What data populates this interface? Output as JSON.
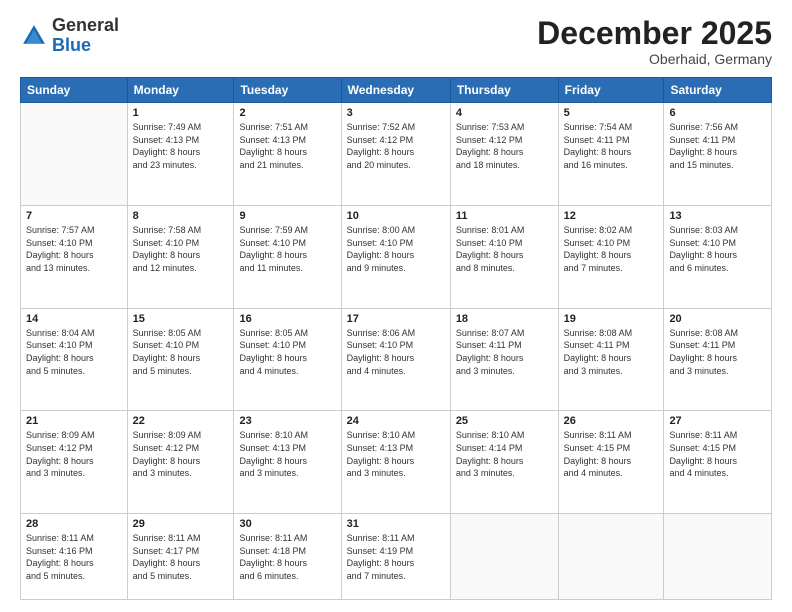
{
  "logo": {
    "general": "General",
    "blue": "Blue"
  },
  "header": {
    "month": "December 2025",
    "location": "Oberhaid, Germany"
  },
  "weekdays": [
    "Sunday",
    "Monday",
    "Tuesday",
    "Wednesday",
    "Thursday",
    "Friday",
    "Saturday"
  ],
  "weeks": [
    [
      {
        "day": "",
        "info": ""
      },
      {
        "day": "1",
        "info": "Sunrise: 7:49 AM\nSunset: 4:13 PM\nDaylight: 8 hours\nand 23 minutes."
      },
      {
        "day": "2",
        "info": "Sunrise: 7:51 AM\nSunset: 4:13 PM\nDaylight: 8 hours\nand 21 minutes."
      },
      {
        "day": "3",
        "info": "Sunrise: 7:52 AM\nSunset: 4:12 PM\nDaylight: 8 hours\nand 20 minutes."
      },
      {
        "day": "4",
        "info": "Sunrise: 7:53 AM\nSunset: 4:12 PM\nDaylight: 8 hours\nand 18 minutes."
      },
      {
        "day": "5",
        "info": "Sunrise: 7:54 AM\nSunset: 4:11 PM\nDaylight: 8 hours\nand 16 minutes."
      },
      {
        "day": "6",
        "info": "Sunrise: 7:56 AM\nSunset: 4:11 PM\nDaylight: 8 hours\nand 15 minutes."
      }
    ],
    [
      {
        "day": "7",
        "info": "Sunrise: 7:57 AM\nSunset: 4:10 PM\nDaylight: 8 hours\nand 13 minutes."
      },
      {
        "day": "8",
        "info": "Sunrise: 7:58 AM\nSunset: 4:10 PM\nDaylight: 8 hours\nand 12 minutes."
      },
      {
        "day": "9",
        "info": "Sunrise: 7:59 AM\nSunset: 4:10 PM\nDaylight: 8 hours\nand 11 minutes."
      },
      {
        "day": "10",
        "info": "Sunrise: 8:00 AM\nSunset: 4:10 PM\nDaylight: 8 hours\nand 9 minutes."
      },
      {
        "day": "11",
        "info": "Sunrise: 8:01 AM\nSunset: 4:10 PM\nDaylight: 8 hours\nand 8 minutes."
      },
      {
        "day": "12",
        "info": "Sunrise: 8:02 AM\nSunset: 4:10 PM\nDaylight: 8 hours\nand 7 minutes."
      },
      {
        "day": "13",
        "info": "Sunrise: 8:03 AM\nSunset: 4:10 PM\nDaylight: 8 hours\nand 6 minutes."
      }
    ],
    [
      {
        "day": "14",
        "info": "Sunrise: 8:04 AM\nSunset: 4:10 PM\nDaylight: 8 hours\nand 5 minutes."
      },
      {
        "day": "15",
        "info": "Sunrise: 8:05 AM\nSunset: 4:10 PM\nDaylight: 8 hours\nand 5 minutes."
      },
      {
        "day": "16",
        "info": "Sunrise: 8:05 AM\nSunset: 4:10 PM\nDaylight: 8 hours\nand 4 minutes."
      },
      {
        "day": "17",
        "info": "Sunrise: 8:06 AM\nSunset: 4:10 PM\nDaylight: 8 hours\nand 4 minutes."
      },
      {
        "day": "18",
        "info": "Sunrise: 8:07 AM\nSunset: 4:11 PM\nDaylight: 8 hours\nand 3 minutes."
      },
      {
        "day": "19",
        "info": "Sunrise: 8:08 AM\nSunset: 4:11 PM\nDaylight: 8 hours\nand 3 minutes."
      },
      {
        "day": "20",
        "info": "Sunrise: 8:08 AM\nSunset: 4:11 PM\nDaylight: 8 hours\nand 3 minutes."
      }
    ],
    [
      {
        "day": "21",
        "info": "Sunrise: 8:09 AM\nSunset: 4:12 PM\nDaylight: 8 hours\nand 3 minutes."
      },
      {
        "day": "22",
        "info": "Sunrise: 8:09 AM\nSunset: 4:12 PM\nDaylight: 8 hours\nand 3 minutes."
      },
      {
        "day": "23",
        "info": "Sunrise: 8:10 AM\nSunset: 4:13 PM\nDaylight: 8 hours\nand 3 minutes."
      },
      {
        "day": "24",
        "info": "Sunrise: 8:10 AM\nSunset: 4:13 PM\nDaylight: 8 hours\nand 3 minutes."
      },
      {
        "day": "25",
        "info": "Sunrise: 8:10 AM\nSunset: 4:14 PM\nDaylight: 8 hours\nand 3 minutes."
      },
      {
        "day": "26",
        "info": "Sunrise: 8:11 AM\nSunset: 4:15 PM\nDaylight: 8 hours\nand 4 minutes."
      },
      {
        "day": "27",
        "info": "Sunrise: 8:11 AM\nSunset: 4:15 PM\nDaylight: 8 hours\nand 4 minutes."
      }
    ],
    [
      {
        "day": "28",
        "info": "Sunrise: 8:11 AM\nSunset: 4:16 PM\nDaylight: 8 hours\nand 5 minutes."
      },
      {
        "day": "29",
        "info": "Sunrise: 8:11 AM\nSunset: 4:17 PM\nDaylight: 8 hours\nand 5 minutes."
      },
      {
        "day": "30",
        "info": "Sunrise: 8:11 AM\nSunset: 4:18 PM\nDaylight: 8 hours\nand 6 minutes."
      },
      {
        "day": "31",
        "info": "Sunrise: 8:11 AM\nSunset: 4:19 PM\nDaylight: 8 hours\nand 7 minutes."
      },
      {
        "day": "",
        "info": ""
      },
      {
        "day": "",
        "info": ""
      },
      {
        "day": "",
        "info": ""
      }
    ]
  ]
}
